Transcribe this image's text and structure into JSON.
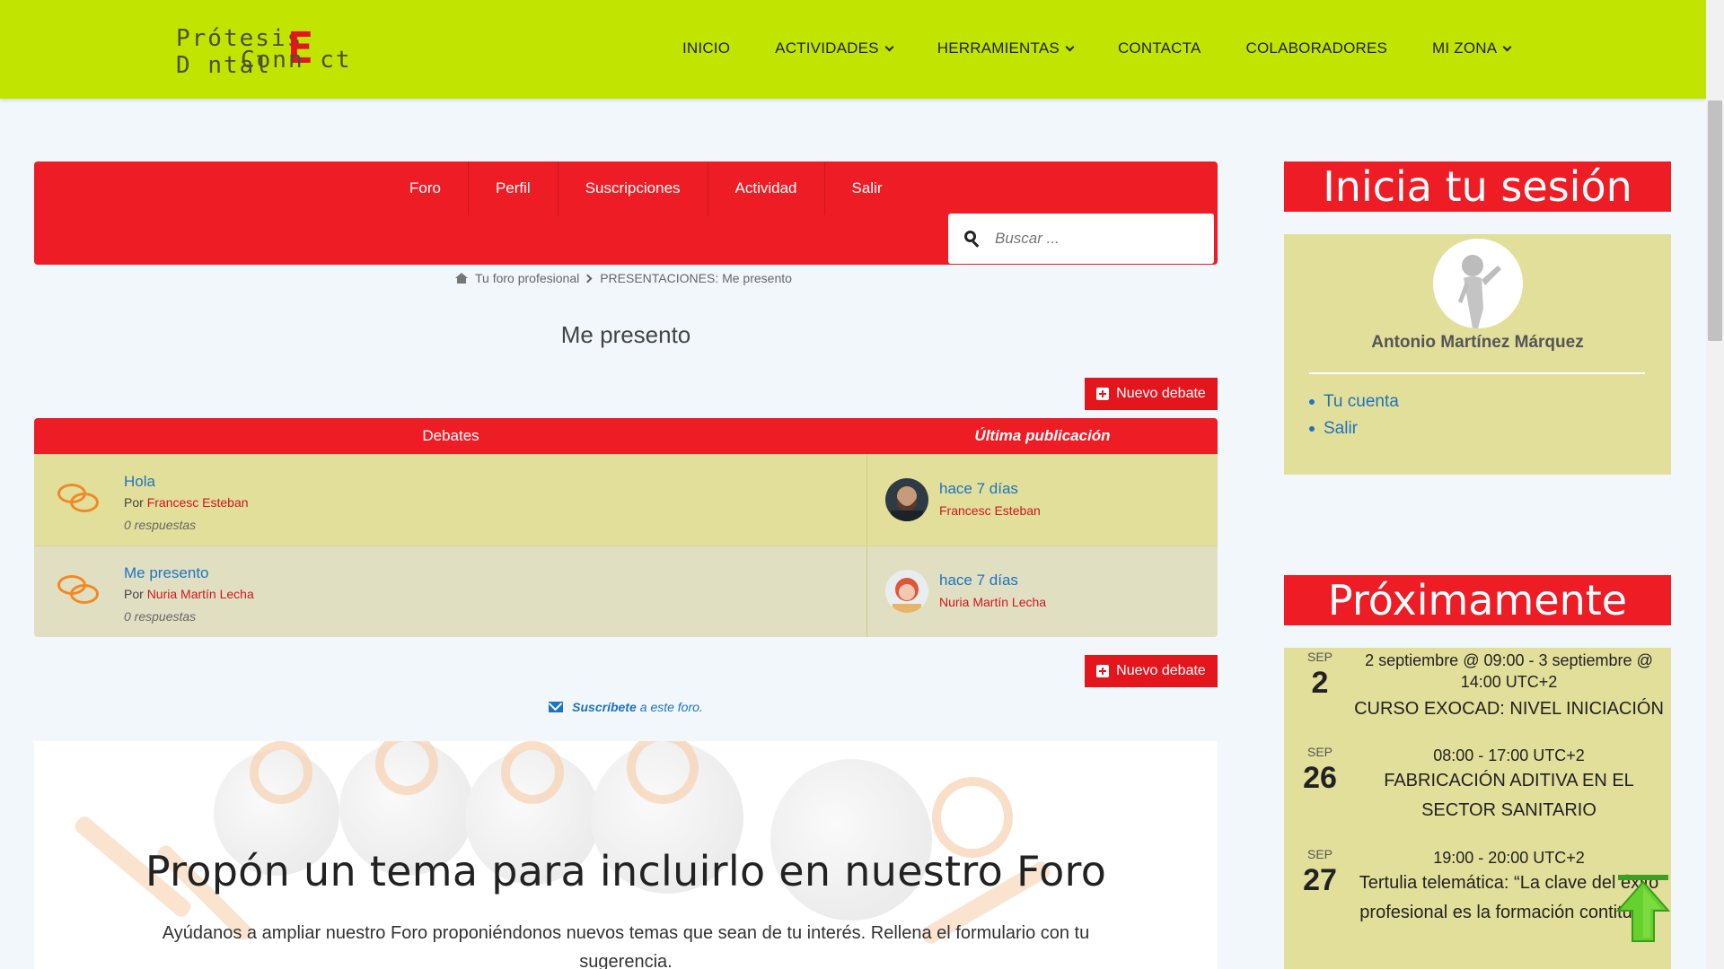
{
  "header": {
    "logo_line1": "Prótesis D",
    "logo_e": "E",
    "logo_line1_rest": "ntal",
    "logo_line2": "Conn",
    "logo_line2_rest": "ct",
    "nav": [
      {
        "label": "INICIO",
        "has_dropdown": false
      },
      {
        "label": "ACTIVIDADES",
        "has_dropdown": true
      },
      {
        "label": "HERRAMIENTAS",
        "has_dropdown": true
      },
      {
        "label": "CONTACTA",
        "has_dropdown": false
      },
      {
        "label": "COLABORADORES",
        "has_dropdown": false
      },
      {
        "label": "MI ZONA",
        "has_dropdown": true
      }
    ],
    "bg_color": "#c2e500"
  },
  "forum_nav": {
    "tabs": [
      "Foro",
      "Perfil",
      "Suscripciones",
      "Actividad",
      "Salir"
    ],
    "search_placeholder": "Buscar ...",
    "accent": "#ee1c25"
  },
  "breadcrumb": {
    "home": "Tu foro profesional",
    "current": "PRESENTACIONES: Me presento"
  },
  "page_title": "Me presento",
  "new_topic_label": "Nuevo debate",
  "table": {
    "col_topics": "Debates",
    "col_last": "Última publicación",
    "rows": [
      {
        "title": "Hola",
        "by_prefix": "Por",
        "author": "Francesc Esteban",
        "replies": "0 respuestas",
        "last_time": "hace 7 días",
        "last_author": "Francesc Esteban"
      },
      {
        "title": "Me presento",
        "by_prefix": "Por",
        "author": "Nuria Martín Lecha",
        "replies": "0 respuestas",
        "last_time": "hace 7 días",
        "last_author": "Nuria Martín Lecha"
      }
    ]
  },
  "subscribe": {
    "strong": "Suscríbete",
    "rest": "a este foro."
  },
  "propose": {
    "title": "Propón un tema para incluirlo en nuestro Foro",
    "text": "Ayúdanos a ampliar nuestro Foro proponiéndonos nuevos temas que sean de tu interés. Rellena el formulario con tu sugerencia."
  },
  "sidebar": {
    "login_title": "Inicia tu sesión",
    "user_name": "Antonio Martínez Márquez",
    "links": [
      "Tu cuenta",
      "Salir"
    ],
    "events_title": "Próximamente",
    "events": [
      {
        "month": "SEP",
        "day": "2",
        "when": "2 septiembre @ 09:00 - 3 septiembre @ 14:00 UTC+2",
        "title": "CURSO EXOCAD: NIVEL INICIACIÓN"
      },
      {
        "month": "SEP",
        "day": "26",
        "when": "08:00 - 17:00 UTC+2",
        "title": "FABRICACIÓN ADITIVA EN EL SECTOR SANITARIO"
      },
      {
        "month": "SEP",
        "day": "27",
        "when": "19:00 - 20:00 UTC+2",
        "title": "Tertulia telemática: “La clave del éxito profesional es la formación contituna”"
      }
    ]
  }
}
